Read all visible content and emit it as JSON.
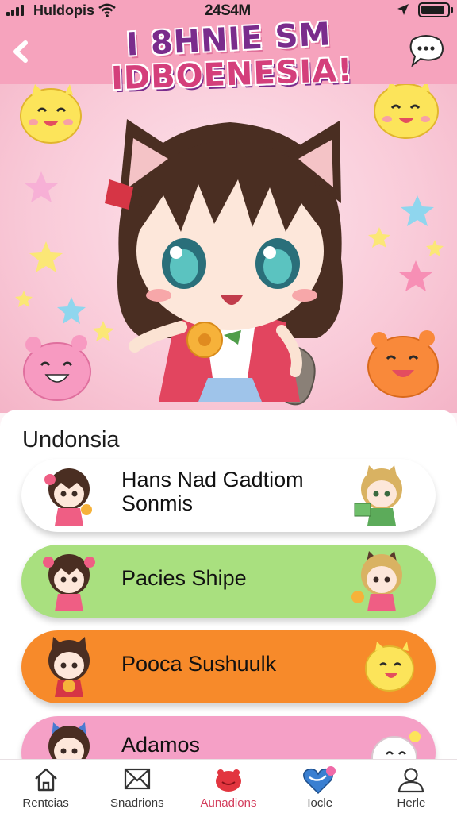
{
  "status_bar": {
    "carrier": "Huldopis",
    "time": "24S4M"
  },
  "header": {
    "title_line1": "I 8HNIE SM",
    "title_line2": "IDBOENESIA!",
    "back_icon": "chevron-left-icon",
    "chat_icon": "chat-bubble-icon"
  },
  "section": {
    "title": "Undonsia"
  },
  "cards": [
    {
      "label_line1": "Hans Nad Gadtiom",
      "label_line2": "Sonmis",
      "color": "#ffffff"
    },
    {
      "label_line1": "Pacies Shipe",
      "label_line2": "",
      "color": "#a9e07f"
    },
    {
      "label_line1": "Pooca Sushuulk",
      "label_line2": "",
      "color": "#f78a2a"
    },
    {
      "label_line1": "Adamos",
      "label_line2": "",
      "color": "#f5a0c6"
    }
  ],
  "nav": {
    "items": [
      {
        "label": "Rentcias",
        "icon": "home-icon",
        "active": false
      },
      {
        "label": "Snadrions",
        "icon": "mail-icon",
        "active": false
      },
      {
        "label": "Aunadions",
        "icon": "mascot-icon",
        "active": true
      },
      {
        "label": "Iocle",
        "icon": "heart-icon",
        "active": false
      },
      {
        "label": "Herle",
        "icon": "profile-icon",
        "active": false
      }
    ]
  },
  "colors": {
    "header_pink": "#f6a3bd",
    "active_red": "#d43f5e",
    "title_purple": "#7a2c8c"
  }
}
